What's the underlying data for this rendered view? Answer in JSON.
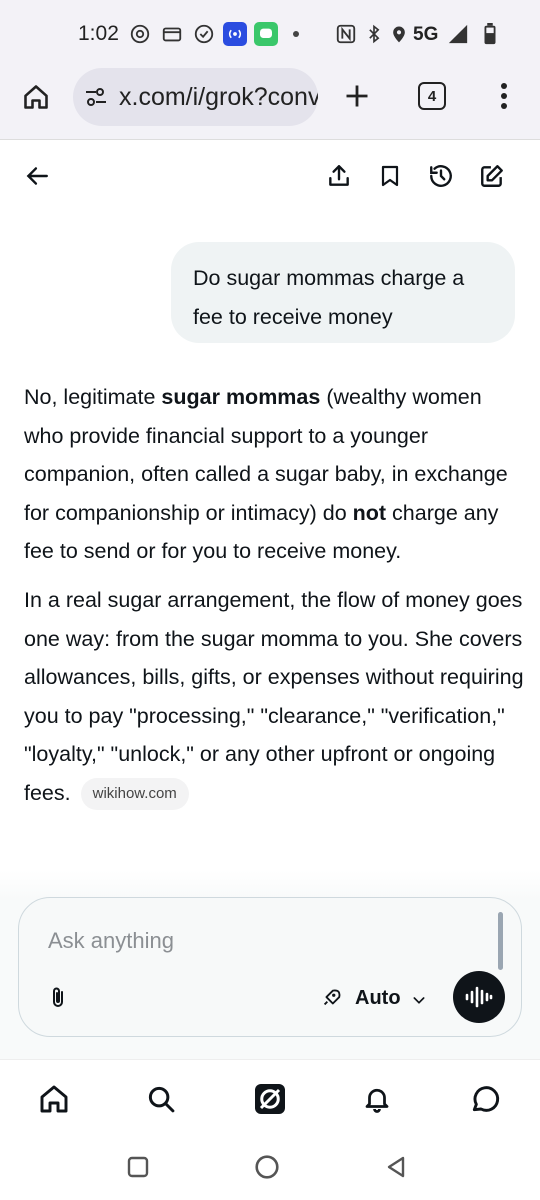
{
  "status_bar": {
    "time": "1:02",
    "network": "5G",
    "icons": [
      "threads-icon",
      "wallet-icon",
      "check-circle-icon",
      "hotspot-icon",
      "messages-icon",
      "dot-icon",
      "nfc-icon",
      "bluetooth-icon",
      "location-icon",
      "signal-icon",
      "battery-icon"
    ]
  },
  "browser": {
    "url": "x.com/i/grok?conversation",
    "tab_count": "4"
  },
  "conversation": {
    "user_message": "Do sugar mommas charge a fee to receive money",
    "answer": {
      "p1_a": "No, legitimate ",
      "p1_b": "sugar mommas",
      "p1_c": " (wealthy women who provide financial support to a younger companion, often called a sugar baby, in exchange for companionship or intimacy) do ",
      "p1_d": "not",
      "p1_e": " charge any fee to send or for you to receive money.",
      "p2": "In a real sugar arrangement, the flow of money goes one way: from the sugar momma to you. She covers allowances, bills, gifts, or expenses without requiring you to pay \"processing,\" \"clearance,\" \"verification,\" \"loyalty,\" \"unlock,\" or any other upfront or ongoing fees.",
      "source": "wikihow.com"
    }
  },
  "composer": {
    "placeholder": "Ask anything",
    "mode": "Auto"
  },
  "colors": {
    "accent": "#0f1419",
    "bubble": "#eff3f4",
    "chrome": "#f3f2f7"
  }
}
